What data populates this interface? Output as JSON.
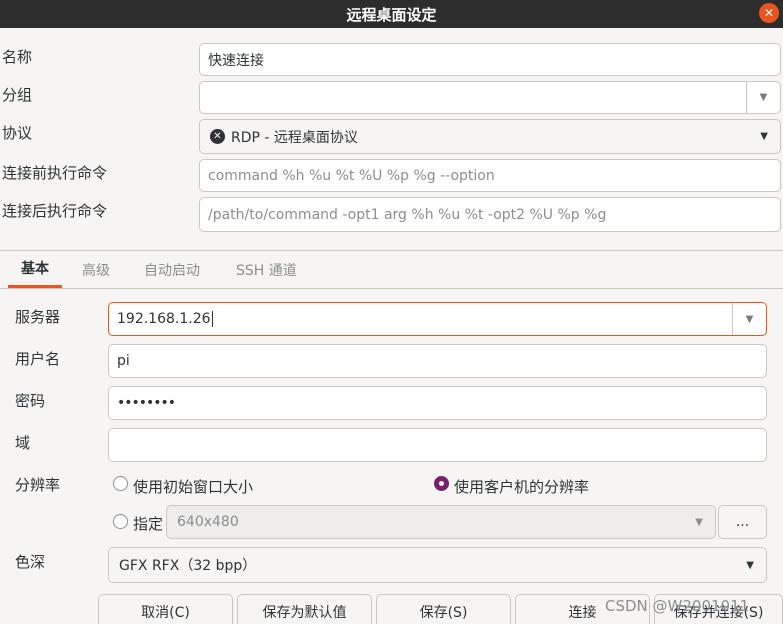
{
  "window": {
    "title": "远程桌面设定"
  },
  "form": {
    "name": {
      "label": "名称",
      "value": "快速连接"
    },
    "group": {
      "label": "分组",
      "value": ""
    },
    "protocol": {
      "label": "协议",
      "value": "RDP - 远程桌面协议"
    },
    "pre_command": {
      "label": "连接前执行命令",
      "placeholder": "command %h %u %t %U %p %g --option"
    },
    "post_command": {
      "label": "连接后执行命令",
      "placeholder": "/path/to/command -opt1 arg %h %u %t -opt2 %U %p %g"
    }
  },
  "tabs": [
    {
      "label": "基本",
      "active": true
    },
    {
      "label": "高级",
      "active": false
    },
    {
      "label": "自动启动",
      "active": false
    },
    {
      "label": "SSH 通道",
      "active": false
    }
  ],
  "basic": {
    "server": {
      "label": "服务器",
      "value": "192.168.1.26"
    },
    "username": {
      "label": "用户名",
      "value": "pi"
    },
    "password": {
      "label": "密码",
      "value": "••••••••"
    },
    "domain": {
      "label": "域",
      "value": ""
    },
    "resolution": {
      "label": "分辨率",
      "option_initial": "使用初始窗口大小",
      "option_client": "使用客户机的分辨率",
      "option_custom": "指定",
      "custom_value": "640x480",
      "more_button": "...",
      "selected": "client"
    },
    "color_depth": {
      "label": "色深",
      "value": "GFX RFX（32 bpp）"
    }
  },
  "buttons": {
    "cancel": "取消(C)",
    "save_default": "保存为默认值",
    "save": "保存(S)",
    "connect": "连接",
    "save_connect": "保存并连接(S)"
  },
  "watermark": "CSDN @W2001011",
  "colors": {
    "accent": "#e95420",
    "radio_checked": "#77216f",
    "titlebar": "#2d2d2d"
  }
}
